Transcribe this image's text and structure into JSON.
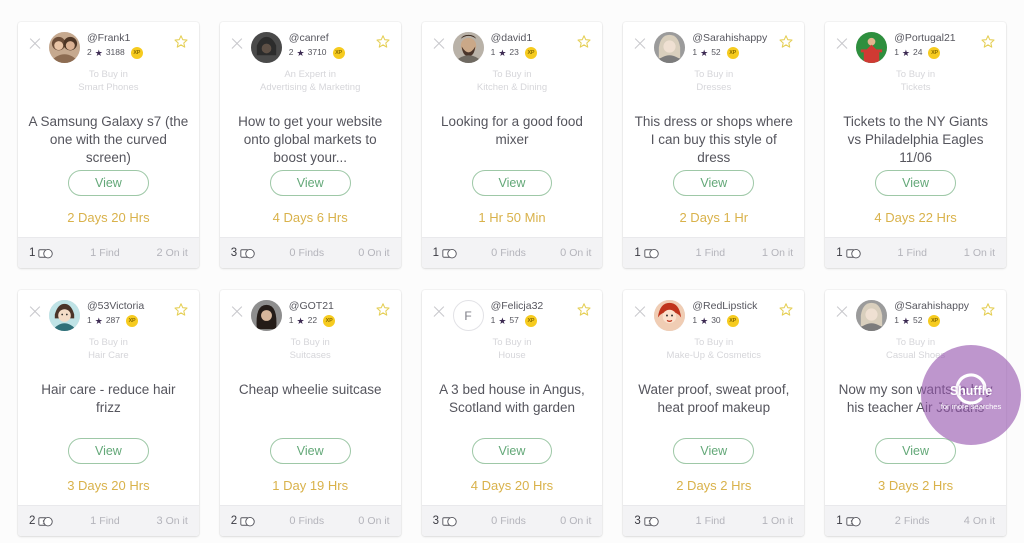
{
  "colors": {
    "page_bg": "#fcfcfc",
    "card_bg": "#ffffff",
    "footer_bg": "#f3f3f5",
    "view_green": "#63a878",
    "timer_gold": "#d9b24b",
    "star_gold": "#e9d25a",
    "xp_yellow": "#f6cb1f",
    "shuffle_purple": "#9656af",
    "title_text": "#55555d",
    "muted_text": "#d6d6da"
  },
  "labels": {
    "view": "View",
    "finds_singular": "Find",
    "finds_plural": "Finds",
    "on_it": "On it",
    "xp": "XP",
    "to_buy_in": "To Buy in"
  },
  "shuffle": {
    "label": "Shuffle",
    "sub_label": "for more searches",
    "icon": "refresh-arc-icon"
  },
  "cards": [
    {
      "handle": "@Frank1",
      "level": "2",
      "points": "3188",
      "category_line1": "To Buy in",
      "category_line2": "Smart Phones",
      "title": "A Samsung Galaxy s7 (the one with the curved screen)",
      "timer": "2 Days 20 Hrs",
      "offers": "1",
      "finds": "1",
      "finds_label": "Find",
      "on_it": "2",
      "on_it_label": "On it",
      "avatar_type": "photo",
      "avatar_kind": "two-women",
      "coin_icon": "coin-stack-icon"
    },
    {
      "handle": "@canref",
      "level": "2",
      "points": "3710",
      "category_line1": "An Expert in",
      "category_line2": "Advertising & Marketing",
      "title": "How to get your website onto global markets to boost your...",
      "timer": "4 Days 6 Hrs",
      "offers": "3",
      "finds": "0",
      "finds_label": "Finds",
      "on_it": "0",
      "on_it_label": "On it",
      "avatar_type": "photo",
      "avatar_kind": "dark-silhouette",
      "coin_icon": "coin-stack-icon"
    },
    {
      "handle": "@david1",
      "level": "1",
      "points": "23",
      "category_line1": "To Buy in",
      "category_line2": "Kitchen & Dining",
      "title": "Looking for a good food mixer",
      "timer": "1 Hr 50 Min",
      "offers": "1",
      "finds": "0",
      "finds_label": "Finds",
      "on_it": "0",
      "on_it_label": "On it",
      "avatar_type": "photo",
      "avatar_kind": "bearded-man",
      "coin_icon": "coin-stack-icon"
    },
    {
      "handle": "@Sarahishappy",
      "level": "1",
      "points": "52",
      "category_line1": "To Buy in",
      "category_line2": "Dresses",
      "title": "This dress or shops where I can buy this style of dress",
      "timer": "2 Days 1 Hr",
      "offers": "1",
      "finds": "1",
      "finds_label": "Find",
      "on_it": "1",
      "on_it_label": "On it",
      "avatar_type": "photo",
      "avatar_kind": "blonde-woman",
      "coin_icon": "coin-stack-icon"
    },
    {
      "handle": "@Portugal21",
      "level": "1",
      "points": "24",
      "category_line1": "To Buy in",
      "category_line2": "Tickets",
      "title": "Tickets to the NY Giants vs Philadelphia Eagles 11/06",
      "timer": "4 Days 22 Hrs",
      "offers": "1",
      "finds": "1",
      "finds_label": "Find",
      "on_it": "1",
      "on_it_label": "On it",
      "avatar_type": "photo",
      "avatar_kind": "green-red-figure",
      "coin_icon": "coin-stack-icon"
    },
    {
      "handle": "@53Victoria",
      "level": "1",
      "points": "287",
      "category_line1": "To Buy in",
      "category_line2": "Hair Care",
      "title": "Hair care - reduce hair frizz",
      "timer": "3 Days 20 Hrs",
      "offers": "2",
      "finds": "1",
      "finds_label": "Find",
      "on_it": "3",
      "on_it_label": "On it",
      "avatar_type": "photo",
      "avatar_kind": "cartoon-woman-teal",
      "coin_icon": "coin-stack-dollar-icon"
    },
    {
      "handle": "@GOT21",
      "level": "1",
      "points": "22",
      "category_line1": "To Buy in",
      "category_line2": "Suitcases",
      "title": "Cheap wheelie suitcase",
      "timer": "1 Day 19 Hrs",
      "offers": "2",
      "finds": "0",
      "finds_label": "Finds",
      "on_it": "0",
      "on_it_label": "On it",
      "avatar_type": "photo",
      "avatar_kind": "dark-long-hair",
      "coin_icon": "coin-stack-icon"
    },
    {
      "handle": "@Felicja32",
      "level": "1",
      "points": "57",
      "category_line1": "To Buy in",
      "category_line2": "House",
      "title": "A 3 bed house in Angus, Scotland with garden",
      "timer": "4 Days 20 Hrs",
      "offers": "3",
      "finds": "0",
      "finds_label": "Finds",
      "on_it": "0",
      "on_it_label": "On it",
      "avatar_type": "letter",
      "avatar_letter": "F",
      "coin_icon": "coin-stack-icon"
    },
    {
      "handle": "@RedLipstick",
      "level": "1",
      "points": "30",
      "category_line1": "To Buy in",
      "category_line2": "Make-Up & Cosmetics",
      "title": "Water proof, sweat proof, heat proof makeup",
      "timer": "2 Days 2 Hrs",
      "offers": "3",
      "finds": "1",
      "finds_label": "Find",
      "on_it": "1",
      "on_it_label": "On it",
      "avatar_type": "photo",
      "avatar_kind": "red-hair-cartoon",
      "coin_icon": "coin-stack-dollar-icon"
    },
    {
      "handle": "@Sarahishappy",
      "level": "1",
      "points": "52",
      "category_line1": "To Buy in",
      "category_line2": "Casual Shoes",
      "title": "Now my son wants to buy his teacher Air Jordans",
      "timer": "3 Days 2 Hrs",
      "offers": "1",
      "finds": "2",
      "finds_label": "Finds",
      "on_it": "4",
      "on_it_label": "On it",
      "avatar_type": "photo",
      "avatar_kind": "blonde-woman",
      "coin_icon": "coin-stack-dollar-icon"
    }
  ]
}
